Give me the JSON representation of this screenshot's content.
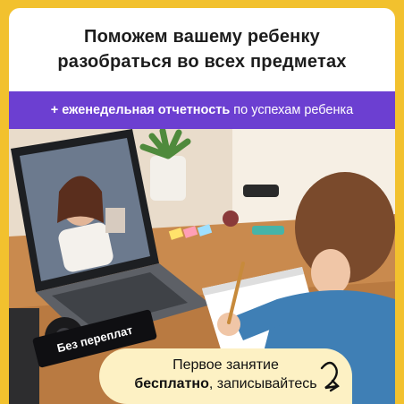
{
  "headline": {
    "line1": "Поможем вашему ребенку",
    "line2": "разобраться во всех предметах"
  },
  "banner": {
    "bold": "+ еженедельная отчетность",
    "plain": "по успехам ребенка"
  },
  "badge": "Без переплат",
  "cta": {
    "line1": "Первое занятие",
    "bold": "бесплатно",
    "rest": ", записывайтесь"
  },
  "colors": {
    "frame": "#f2c12e",
    "banner": "#6c3fd1",
    "cta_bg": "#fdf1c4",
    "badge_bg": "#0f0f12"
  }
}
